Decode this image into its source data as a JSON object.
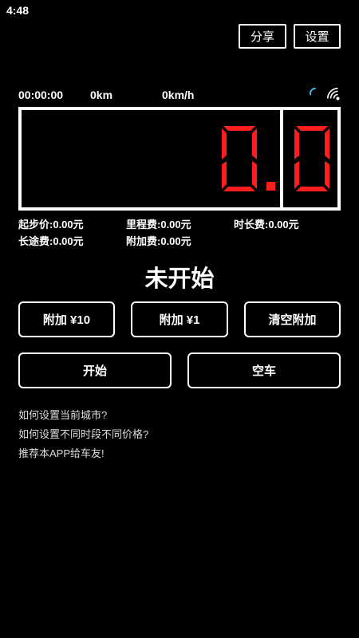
{
  "status_bar": {
    "time": "4:48"
  },
  "header": {
    "share_label": "分享",
    "settings_label": "设置"
  },
  "stats": {
    "duration": "00:00:00",
    "distance": "0km",
    "speed": "0km/h"
  },
  "meter": {
    "digits": [
      "0",
      "0"
    ],
    "segment_color": "#ff1e1e"
  },
  "fees": {
    "start": {
      "label": "起步价:",
      "value": "0.00元"
    },
    "mileage": {
      "label": "里程费:",
      "value": "0.00元"
    },
    "time": {
      "label": "时长费:",
      "value": "0.00元"
    },
    "long_distance": {
      "label": "长途费:",
      "value": "0.00元"
    },
    "extra": {
      "label": "附加费:",
      "value": "0.00元"
    }
  },
  "trip_status": "未开始",
  "buttons": {
    "add10": "附加 ¥10",
    "add1": "附加 ¥1",
    "clear_extra": "清空附加",
    "start": "开始",
    "vacant": "空车"
  },
  "links": [
    "如何设置当前城市?",
    "如何设置不同时段不同价格?",
    "推荐本APP给车友!"
  ],
  "icons": {
    "loading": "loading-spinner-icon",
    "gps": "gps-signal-icon"
  },
  "colors": {
    "background": "#000000",
    "foreground": "#ffffff",
    "digits": "#ff1e1e"
  }
}
